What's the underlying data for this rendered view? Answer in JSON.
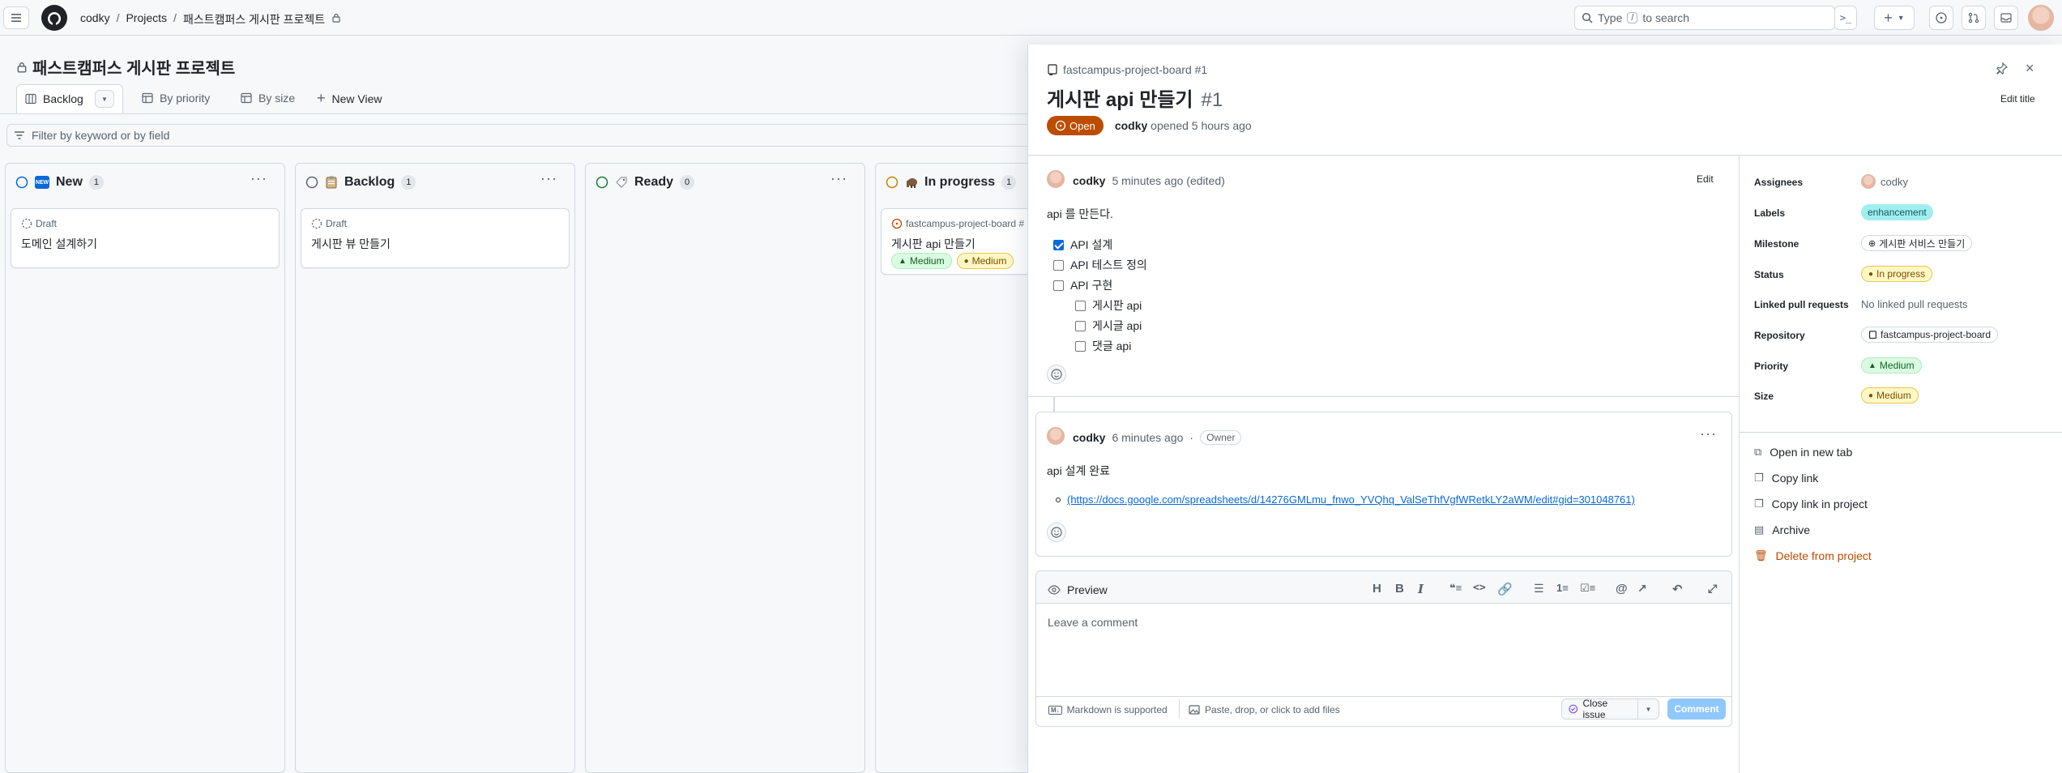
{
  "header": {
    "breadcrumb": [
      "codky",
      "Projects",
      "패스트캠퍼스 게시판 프로젝트"
    ],
    "search_placeholder_pre": "Type",
    "search_key": "/",
    "search_placeholder_post": "to search"
  },
  "project": {
    "title": "패스트캠퍼스 게시판 프로젝트",
    "views": [
      "Backlog",
      "By priority",
      "By size"
    ],
    "new_view": "New View",
    "filter_placeholder": "Filter by keyword or by field"
  },
  "columns": [
    {
      "name": "New",
      "count": "1",
      "cards": [
        {
          "sub": "Draft",
          "title": "도메인 설계하기"
        }
      ]
    },
    {
      "name": "Backlog",
      "count": "1",
      "cards": [
        {
          "sub": "Draft",
          "title": "게시판 뷰 만들기"
        }
      ]
    },
    {
      "name": "Ready",
      "count": "0",
      "cards": []
    },
    {
      "name": "In progress",
      "count": "1",
      "cards": [
        {
          "sub": "fastcampus-project-board #",
          "title": "게시판 api 만들기",
          "badges": [
            "Medium",
            "Medium"
          ]
        }
      ]
    }
  ],
  "issue": {
    "repo_ref": "fastcampus-project-board #1",
    "title": "게시판 api 만들기",
    "number": "#1",
    "status": "Open",
    "author": "codky",
    "opened": "opened 5 hours ago",
    "edit_title": "Edit title"
  },
  "body_comment": {
    "author": "codky",
    "time": "5 minutes ago (edited)",
    "edit": "Edit",
    "text": "api 를 만든다.",
    "tasks": [
      {
        "label": "API 설계",
        "checked": true,
        "level": 0
      },
      {
        "label": "API 테스트 정의",
        "checked": false,
        "level": 0
      },
      {
        "label": "API 구현",
        "checked": false,
        "level": 0
      },
      {
        "label": "게시판 api",
        "checked": false,
        "level": 1
      },
      {
        "label": "게시글 api",
        "checked": false,
        "level": 1
      },
      {
        "label": "댓글 api",
        "checked": false,
        "level": 1
      }
    ]
  },
  "comment2": {
    "author": "codky",
    "time": "6 minutes ago",
    "role": "Owner",
    "text": "api 설계 완료",
    "link": "(https://docs.google.com/spreadsheets/d/14276GMLmu_fnwo_YVQhq_ValSeThfVgfWRetkLY2aWM/edit#gid=301048761)"
  },
  "editor": {
    "preview": "Preview",
    "placeholder": "Leave a comment",
    "markdown": "Markdown is supported",
    "attach": "Paste, drop, or click to add files",
    "close_issue": "Close issue",
    "comment": "Comment"
  },
  "sidebar": {
    "fields": [
      {
        "label": "Assignees",
        "value": "codky"
      },
      {
        "label": "Labels",
        "value": "enhancement"
      },
      {
        "label": "Milestone",
        "value": "게시판 서비스 만들기"
      },
      {
        "label": "Status",
        "value": "In progress"
      },
      {
        "label": "Linked pull requests",
        "value": "No linked pull requests"
      },
      {
        "label": "Repository",
        "value": "fastcampus-project-board"
      },
      {
        "label": "Priority",
        "value": "Medium"
      },
      {
        "label": "Size",
        "value": "Medium"
      }
    ],
    "actions": [
      "Open in new tab",
      "Copy link",
      "Copy link in project",
      "Archive",
      "Delete from project"
    ]
  },
  "colors": {
    "open": "#bc4c00",
    "accent": "#0969da",
    "danger": "#d1242f",
    "label_enhancement": "#a2eeef",
    "medium_green": "#dafbe1",
    "medium_yellow": "#fff8c5"
  }
}
